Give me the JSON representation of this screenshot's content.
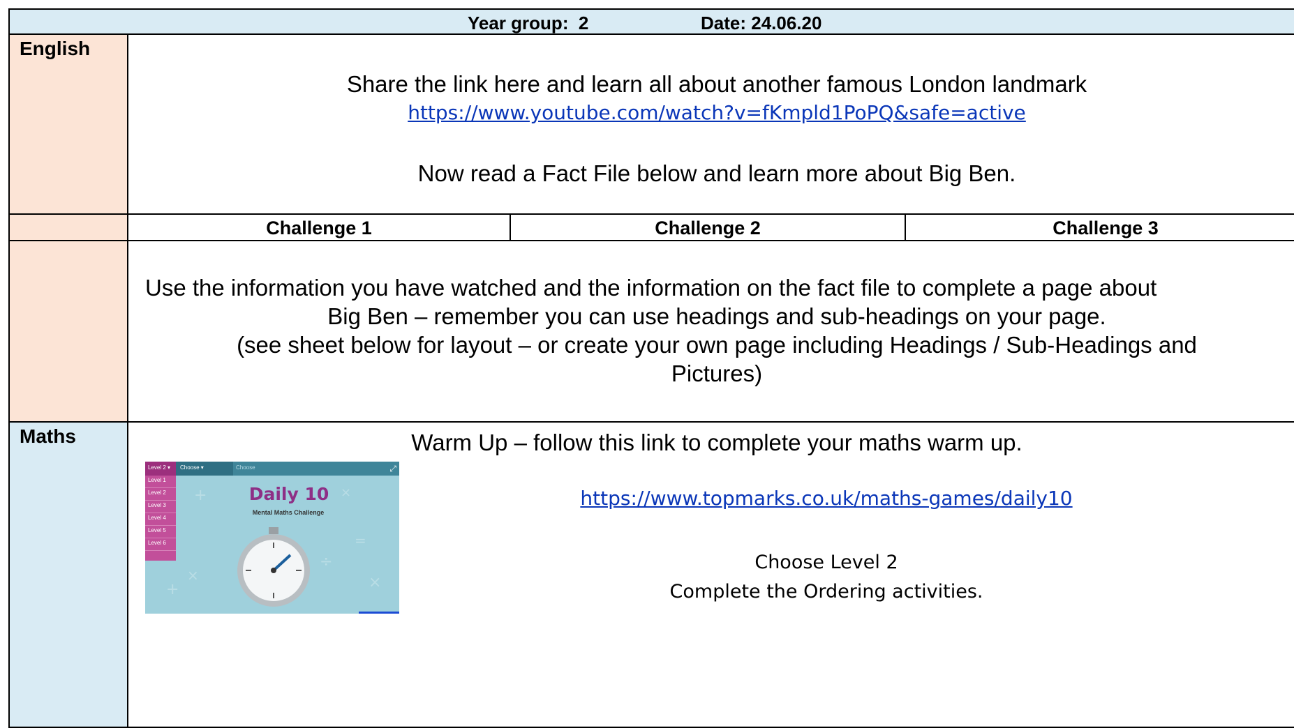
{
  "header": {
    "year_group": "Year group:  2",
    "date": "Date: 24.06.20"
  },
  "english": {
    "label": "English",
    "intro": "Share the link here and learn all about another famous London landmark",
    "video_link": "https://www.youtube.com/watch?v=fKmpld1PoPQ&safe=active",
    "fact_file": "Now read a Fact File below and learn more about Big Ben.",
    "challenges": [
      "Challenge 1",
      "Challenge 2",
      "Challenge 3"
    ],
    "task_lines": [
      "Use the information you have watched and the information on the fact file to complete a page about",
      "Big Ben – remember you can use headings and sub-headings on your page.",
      "(see sheet below for layout – or create your own page including Headings / Sub-Headings and",
      "Pictures)"
    ]
  },
  "maths": {
    "label": "Maths",
    "warm_up": "Warm Up – follow this link to complete your maths warm up.",
    "link": "https://www.topmarks.co.uk/maths-games/daily10",
    "instructions": [
      "Choose Level 2",
      "Complete the Ordering activities."
    ],
    "thumbnail": {
      "level_tab": "Level 2 ▾",
      "choose_tab": "Choose ▾",
      "choose_label": "Choose",
      "levels": [
        "Level 1",
        "Level 2",
        "Level 3",
        "Level 4",
        "Level 5",
        "Level 6"
      ],
      "title": "Daily 10",
      "subtitle": "Mental Maths Challenge",
      "expand_icon": "expand-icon",
      "timer_icon": "stopwatch-icon"
    }
  },
  "colors": {
    "header_bg": "#d9ebf4",
    "english_bg": "#fce4d6",
    "maths_bg": "#d9ebf4",
    "link": "#0a36b8"
  }
}
